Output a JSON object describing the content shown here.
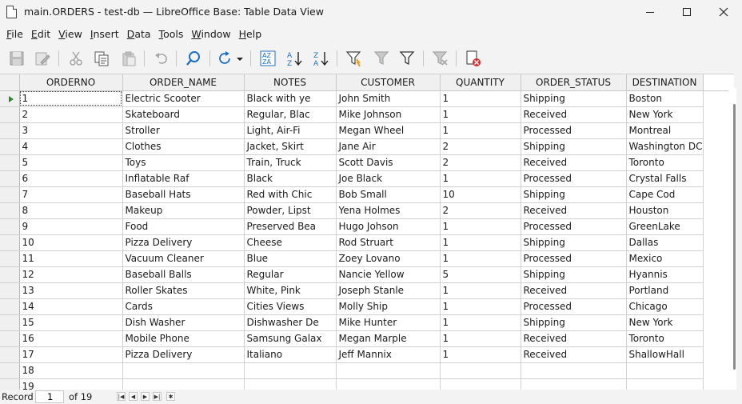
{
  "window": {
    "title": "main.ORDERS - test-db — LibreOffice Base: Table Data View"
  },
  "menu": [
    {
      "label": "File",
      "key": "F",
      "rest": "ile"
    },
    {
      "label": "Edit",
      "key": "E",
      "rest": "dit"
    },
    {
      "label": "View",
      "key": "V",
      "rest": "iew"
    },
    {
      "label": "Insert",
      "key": "I",
      "rest": "nsert"
    },
    {
      "label": "Data",
      "key": "D",
      "rest": "ata"
    },
    {
      "label": "Tools",
      "key": "T",
      "rest": "ools"
    },
    {
      "label": "Window",
      "key": "W",
      "rest": "indow"
    },
    {
      "label": "Help",
      "key": "H",
      "rest": "elp"
    }
  ],
  "toolbar": {
    "icons": [
      "save-record-icon",
      "edit-data-icon",
      "cut-icon",
      "copy-icon",
      "paste-icon",
      "undo-icon",
      "find-record-icon",
      "refresh-icon",
      "refresh-dropdown-icon",
      "sort-icon",
      "sort-ascending-icon",
      "sort-descending-icon",
      "autofilter-icon",
      "apply-filter-icon",
      "standard-filter-icon",
      "reset-filter-icon",
      "delete-record-icon"
    ]
  },
  "grid": {
    "columns": [
      "ORDERNO",
      "ORDER_NAME",
      "NOTES",
      "CUSTOMER",
      "QUANTITY",
      "ORDER_STATUS",
      "DESTINATION"
    ],
    "rows": [
      [
        "1",
        "Electric Scooter",
        "Black with ye",
        "John Smith",
        "1",
        "Shipping",
        "Boston"
      ],
      [
        "2",
        "Skateboard",
        "Regular, Blac",
        "Mike Johnson",
        "1",
        "Received",
        "New York"
      ],
      [
        "3",
        "Stroller",
        "Light, Air-Fi",
        "Megan Wheel",
        "1",
        "Processed",
        "Montreal"
      ],
      [
        "4",
        "Clothes",
        "Jacket, Skirt",
        "Jane Air",
        "2",
        "Shipping",
        "Washington DC"
      ],
      [
        "5",
        "Toys",
        "Train, Truck",
        "Scott Davis",
        "2",
        "Received",
        "Toronto"
      ],
      [
        "6",
        "Inflatable Raf",
        "Black",
        "Joe Black",
        "1",
        "Processed",
        "Crystal Falls"
      ],
      [
        "7",
        "Baseball Hats",
        "Red with Chic",
        "Bob Small",
        "10",
        "Shipping",
        "Cape Cod"
      ],
      [
        "8",
        "Makeup",
        "Powder, Lipst",
        "Yena Holmes",
        "2",
        "Received",
        "Houston"
      ],
      [
        "9",
        "Food",
        "Preserved Bea",
        "Hugo Johson",
        "1",
        "Processed",
        "GreenLake"
      ],
      [
        "10",
        "Pizza Delivery",
        "Cheese",
        "Rod Struart",
        "1",
        "Shipping",
        "Dallas"
      ],
      [
        "11",
        "Vacuum Cleaner",
        "Blue",
        "Zoey Lovano",
        "1",
        "Processed",
        "Mexico"
      ],
      [
        "12",
        "Baseball Balls",
        "Regular",
        "Nancie Yellow",
        "5",
        "Shipping",
        "Hyannis"
      ],
      [
        "13",
        "Roller Skates",
        "White, Pink",
        "Joseph Stanle",
        "1",
        "Received",
        "Portland"
      ],
      [
        "14",
        "Cards",
        "Cities Views",
        "Molly Ship",
        "1",
        "Processed",
        "Chicago"
      ],
      [
        "15",
        "Dish Washer",
        "Dishwasher De",
        "Mike Hunter",
        "1",
        "Shipping",
        "New York"
      ],
      [
        "16",
        "Mobile Phone",
        "Samsung Galax",
        "Megan Marple",
        "1",
        "Received",
        "Toronto"
      ],
      [
        "17",
        "Pizza Delivery",
        "Italiano",
        "Jeff Mannix",
        "1",
        "Received",
        "ShallowHall"
      ],
      [
        "18",
        "",
        "",
        "",
        "",
        "",
        ""
      ],
      [
        "19",
        "",
        "",
        "",
        "",
        "",
        ""
      ]
    ]
  },
  "navigation": {
    "record_label": "Record",
    "record_value": "1",
    "of_label": "of 19"
  },
  "colors": {
    "current_row_marker": "#2c8a2c",
    "header_bg": "#f0f0f0"
  }
}
